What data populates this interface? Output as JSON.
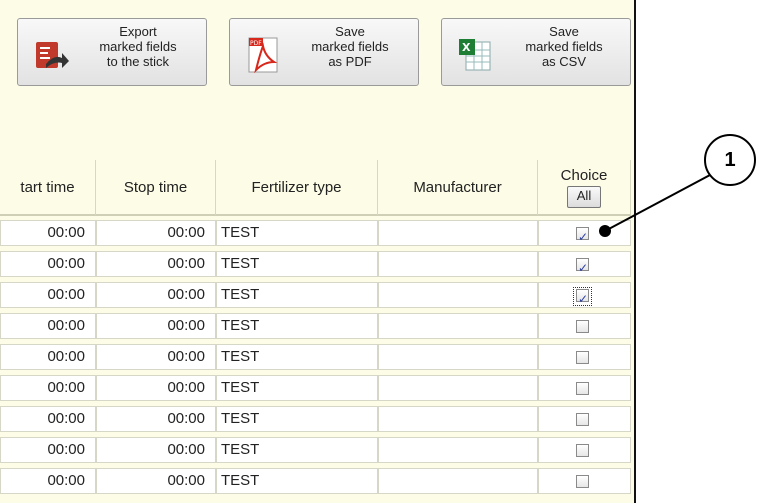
{
  "toolbar": {
    "export_label": "Export\nmarked fields\nto the stick",
    "export_icon": "export-to-stick-icon",
    "pdf_label": "Save\nmarked fields\nas PDF",
    "pdf_icon": "pdf-document-icon",
    "csv_label": "Save\nmarked fields\nas CSV",
    "csv_icon": "spreadsheet-icon"
  },
  "table": {
    "columns": [
      "tart time",
      "Stop time",
      "Fertilizer type",
      "Manufacturer",
      "Choice"
    ],
    "all_button": "All",
    "rows": [
      {
        "start": "00:00",
        "stop": "00:00",
        "type": "TEST",
        "manufacturer": "",
        "checked": true
      },
      {
        "start": "00:00",
        "stop": "00:00",
        "type": "TEST",
        "manufacturer": "",
        "checked": true
      },
      {
        "start": "00:00",
        "stop": "00:00",
        "type": "TEST",
        "manufacturer": "",
        "checked": true,
        "focused": true
      },
      {
        "start": "00:00",
        "stop": "00:00",
        "type": "TEST",
        "manufacturer": "",
        "checked": false
      },
      {
        "start": "00:00",
        "stop": "00:00",
        "type": "TEST",
        "manufacturer": "",
        "checked": false
      },
      {
        "start": "00:00",
        "stop": "00:00",
        "type": "TEST",
        "manufacturer": "",
        "checked": false
      },
      {
        "start": "00:00",
        "stop": "00:00",
        "type": "TEST",
        "manufacturer": "",
        "checked": false
      },
      {
        "start": "00:00",
        "stop": "00:00",
        "type": "TEST",
        "manufacturer": "",
        "checked": false
      },
      {
        "start": "00:00",
        "stop": "00:00",
        "type": "TEST",
        "manufacturer": "",
        "checked": false
      }
    ]
  },
  "callout": {
    "label": "1"
  },
  "colors": {
    "background": "#fdfce6",
    "check": "#2c3ea4"
  }
}
